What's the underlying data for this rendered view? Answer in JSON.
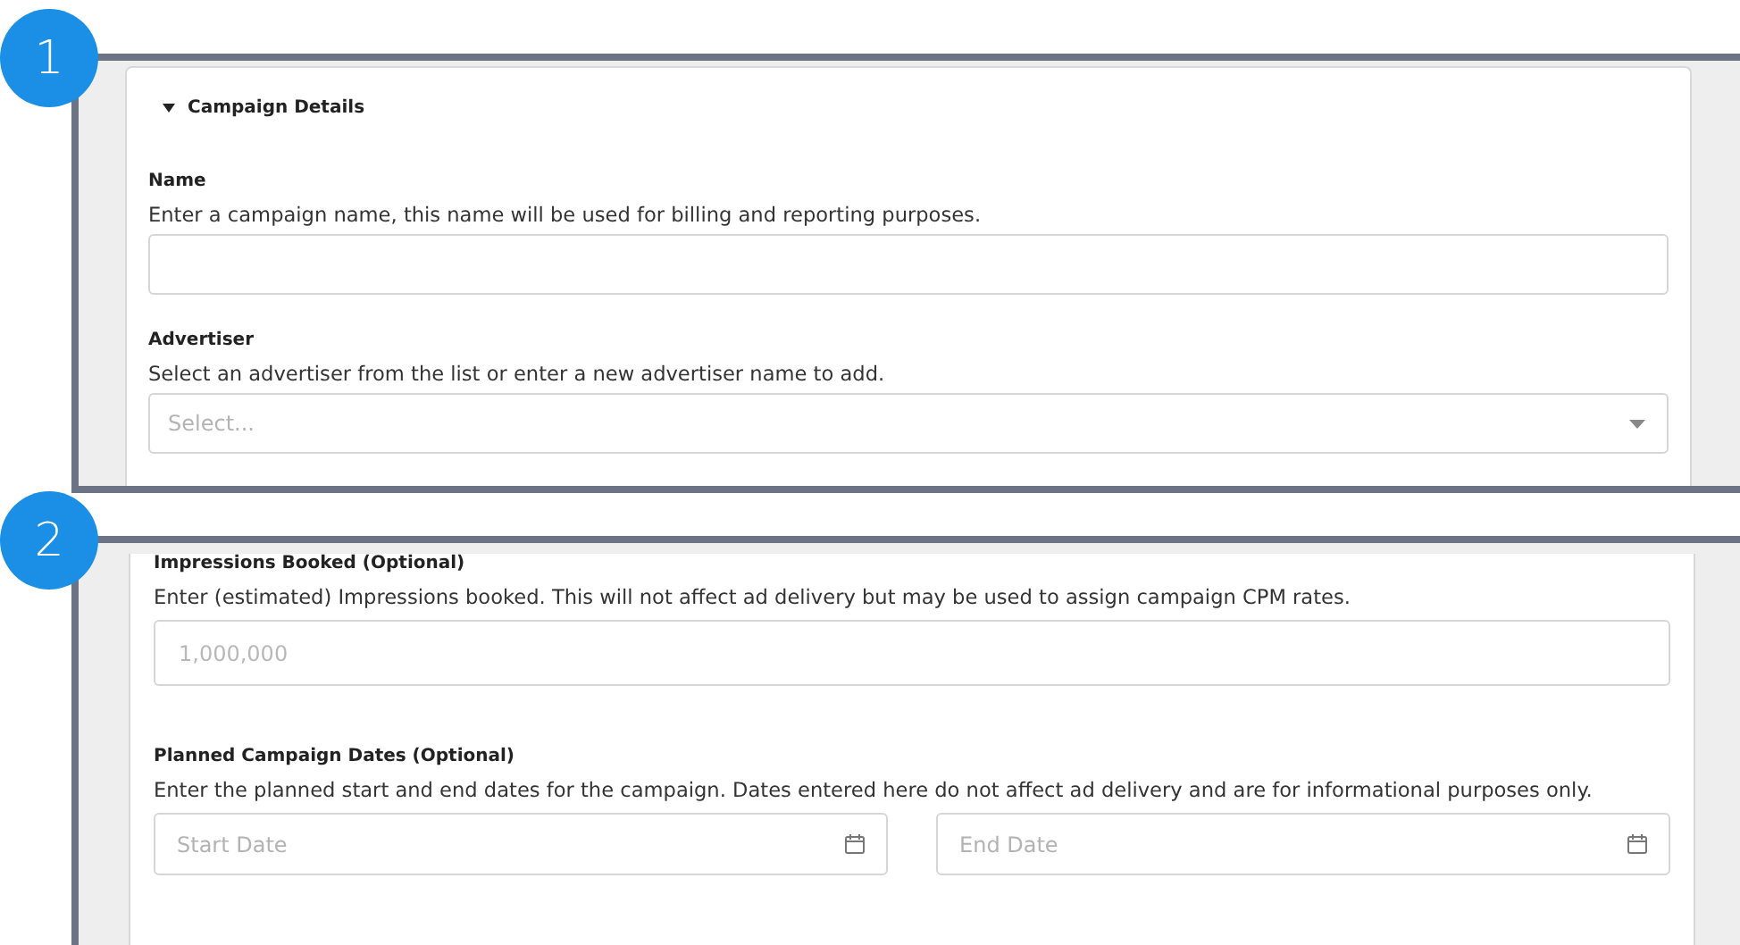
{
  "callouts": [
    {
      "number": "1",
      "section": {
        "title": "Campaign Details",
        "expanded": true,
        "fields": [
          {
            "kind": "text",
            "label": "Name",
            "help": "Enter a campaign name, this name will be used for billing and reporting purposes."
          },
          {
            "kind": "select",
            "label": "Advertiser",
            "help": "Select an advertiser from the list or enter a new advertiser name to add.",
            "placeholder": "Select..."
          }
        ]
      }
    },
    {
      "number": "2",
      "section": {
        "fields": [
          {
            "kind": "text",
            "label": "Impressions Booked (Optional)",
            "help": "Enter (estimated) Impressions booked. This will not affect ad delivery but may be used to assign campaign CPM rates.",
            "placeholder": "1,000,000"
          },
          {
            "kind": "date_range",
            "label": "Planned Campaign Dates (Optional)",
            "help": "Enter the planned start and end dates for the campaign. Dates entered here do not affect ad delivery and are for informational purposes only.",
            "inputs": [
              {
                "placeholder": "Start Date"
              },
              {
                "placeholder": "End Date"
              }
            ]
          }
        ]
      }
    }
  ]
}
